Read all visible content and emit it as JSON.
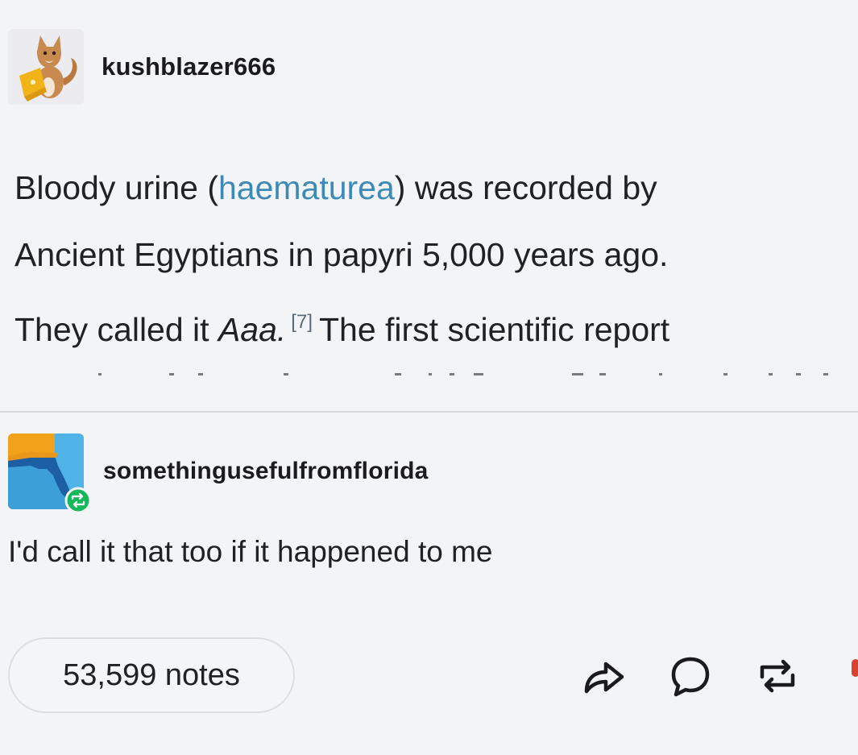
{
  "post": {
    "username": "kushblazer666",
    "avatar_icon": "fox-with-laptop-avatar",
    "text_before_link": "Bloody urine (",
    "link_text": "haematurea",
    "text_after_link_line1": ") was recorded by",
    "text_line2": "Ancient Egyptians in papyri 5,000 years ago.",
    "text_line3_start": "They called it ",
    "italic_word": "Aaa.",
    "reference": "[7]",
    "text_line3_end": "The first scientific report",
    "link_color": "#3d8ab7"
  },
  "reply": {
    "username": "somethingusefulfromflorida",
    "avatar_icon": "florida-map-avatar",
    "reblog_badge_icon": "reblog-badge-icon",
    "text": "I'd call it that too if it happened to me"
  },
  "footer": {
    "notes_label": "53,599 notes",
    "actions": [
      "share-icon",
      "reply-icon",
      "reblog-icon"
    ]
  }
}
